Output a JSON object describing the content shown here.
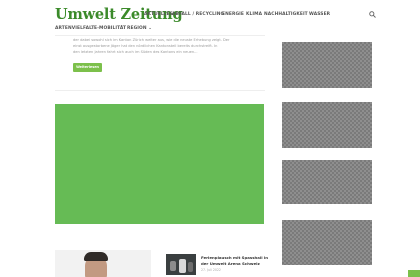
{
  "header": {
    "logo": "Umwelt Zeitung",
    "nav_primary": [
      "AKTUELLES",
      "ABFALL / RECYCLING",
      "ENERGIE",
      "KLIMA",
      "NACHHALTIGKEIT",
      "WASSER"
    ],
    "nav_secondary": [
      "ARTENVIELFALT",
      "E-MOBILITÄT",
      "REGION ⌄"
    ],
    "search_icon": "search-icon"
  },
  "article": {
    "excerpt_lines": [
      "der dabei sowohl sich im Kanton Zürich weiter aus, wie die neuste Erhebung zeigt. Der",
      "einst ausgestorbene Jäger hat den nördlichen Kantonsteil bereits durchstreift. In",
      "den letzten Jahren fahrt sich auch im Süden des Kantons ein neuen..."
    ],
    "more_label": "Weiterlesen"
  },
  "sidebar_article": {
    "title_lines": [
      "Ferienplausch mit Spasshall in",
      "der Umwelt Arena Schweiz"
    ],
    "date": "27. Juli 2022"
  },
  "colors": {
    "brand_green": "#3b8a2a",
    "accent_green": "#7cc04b",
    "banner_green": "#66bb55"
  }
}
